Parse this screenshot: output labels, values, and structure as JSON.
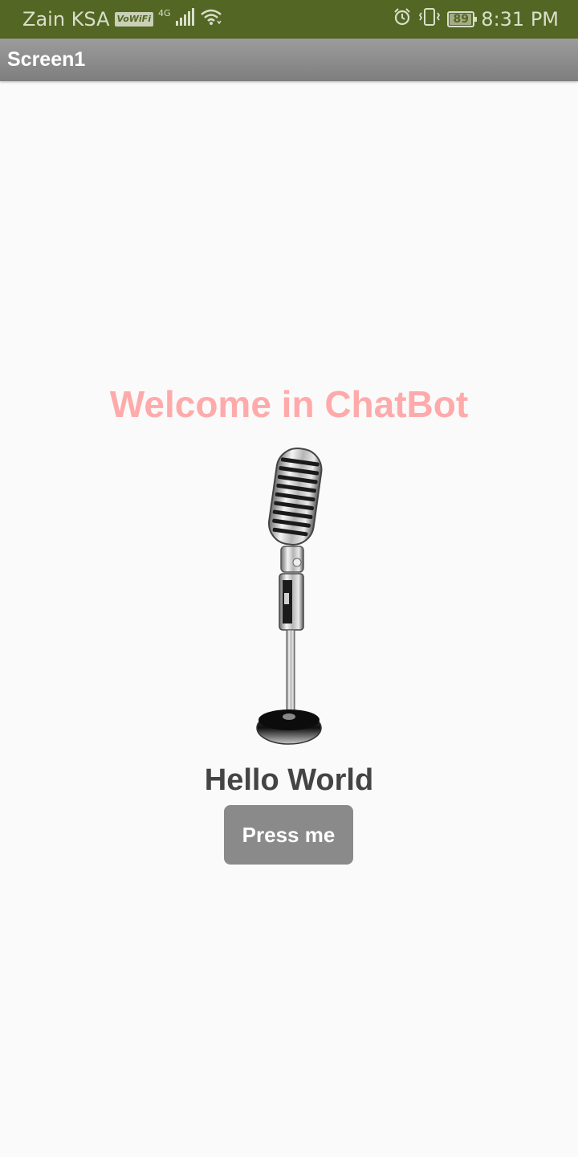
{
  "status_bar": {
    "carrier": "Zain KSA",
    "vowifi_label": "VoWiFi",
    "network_type": "4G",
    "battery_level": "89",
    "time": "8:31 PM",
    "icons": [
      "signal-icon",
      "wifi-icon",
      "alarm-icon",
      "vibrate-icon",
      "battery-icon"
    ],
    "background_color": "#546624"
  },
  "title_bar": {
    "title": "Screen1"
  },
  "main": {
    "welcome_text": "Welcome in ChatBot",
    "welcome_color": "#ffaaaa",
    "image": "microphone-image",
    "hello_text": "Hello World",
    "button_label": "Press me"
  }
}
